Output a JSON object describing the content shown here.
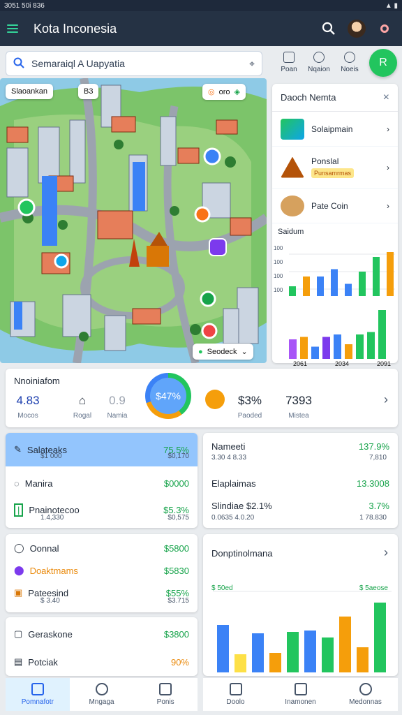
{
  "statusbar": {
    "time": "3051 50i 836",
    "icons": "wifi battery"
  },
  "appbar": {
    "title": "Kota Inconesia"
  },
  "search": {
    "value": "Semaraiql A Uapyatia"
  },
  "quick_actions": [
    {
      "label": "Poan"
    },
    {
      "label": "Nqaion"
    },
    {
      "label": "Noeis"
    }
  ],
  "fab": {
    "label": "R"
  },
  "map": {
    "chip_left": "Slaoankan",
    "chip_left2": "B3",
    "chip_right": "oro",
    "search_chip": "Seodeck"
  },
  "side_panel": {
    "title": "Daoch Nemta",
    "items": [
      {
        "label": "Solaipmain"
      },
      {
        "label": "Ponslal",
        "tag": "Punsamrmas"
      },
      {
        "label": "Pate Coin"
      }
    ],
    "chart_title": "Saidum"
  },
  "chart_data": [
    {
      "type": "bar",
      "title": "Saidum",
      "categories": [
        "2061",
        "2034",
        "2091"
      ],
      "ylim": [
        0,
        100
      ],
      "yticks": [
        "100",
        "100",
        "100",
        "100"
      ],
      "series": [
        {
          "name": "",
          "color": "#22c55e",
          "values": [
            18,
            25,
            30,
            80
          ]
        },
        {
          "name": "",
          "color": "#f59e0b",
          "values": [
            40,
            52,
            60,
            85
          ]
        },
        {
          "name": "",
          "color": "#3b82f6",
          "values": [
            30,
            35,
            45,
            50
          ]
        }
      ]
    },
    {
      "type": "bar",
      "title": "",
      "categories": [
        "2061",
        "2034",
        "2091"
      ],
      "ylim": [
        0,
        100
      ],
      "series": [
        {
          "name": "",
          "values": [
            55,
            40,
            45,
            90
          ]
        }
      ]
    },
    {
      "type": "bar",
      "title": "Donptinolmana",
      "categories": [],
      "ylim": [
        0,
        100
      ],
      "series": [
        {
          "name": "",
          "values": [
            68,
            26,
            56,
            28,
            58,
            60,
            50,
            80,
            36,
            100
          ]
        }
      ]
    }
  ],
  "stats": {
    "label": "Nnoiniafom",
    "s1_value": "4.83",
    "s1_label": "Mocos",
    "s2_label": "Rogal",
    "s3_value": "0.9",
    "s3_label": "Namia",
    "ring_value": "$47%",
    "s4_value": "$3%",
    "s4_label": "Paoded",
    "s5_value": "7393",
    "s5_label": "Mistea"
  },
  "card1": {
    "rows": [
      {
        "name": "Salateaks",
        "val": "75.5%",
        "sub": "$1 000",
        "subval": "$0,170"
      },
      {
        "name": "Manira",
        "val": "$0000"
      },
      {
        "name": "Pnainotecoo",
        "val": "$5.3%",
        "sub": "1.4,330",
        "subval": "$0,575"
      }
    ]
  },
  "card2": {
    "rows": [
      {
        "name": "Nameeti",
        "val": "137.9%",
        "sub": "3.30 4 8.33",
        "subval": "7,810"
      },
      {
        "name": "Elaplaimas",
        "val": "13.3008"
      },
      {
        "name": "Slindiae $2.1%",
        "val": "3.7%",
        "sub": "0.0635 4.0.20",
        "subval": "1 78.830"
      }
    ]
  },
  "card3": {
    "rows": [
      {
        "name": "Oonnal",
        "val": "$5800"
      },
      {
        "name": "Doaktmams",
        "val": "$5830"
      },
      {
        "name": "Pateesind",
        "val": "$55%",
        "sub": "$ 3.40",
        "subval": "$3.715"
      }
    ]
  },
  "card4": {
    "rows": [
      {
        "name": "Geraskone",
        "val": "$3800"
      },
      {
        "name": "Potciak",
        "val": "90%"
      }
    ]
  },
  "card5": {
    "title": "Donptinolmana",
    "left": "$ 50ed",
    "right": "$ 5aeose"
  },
  "nav_left": [
    {
      "label": "Pomnafotr"
    },
    {
      "label": "Mngaga"
    },
    {
      "label": "Ponis"
    }
  ],
  "nav_right": [
    {
      "label": "Doolo"
    },
    {
      "label": "Inamonen"
    },
    {
      "label": "Medonnas"
    }
  ]
}
